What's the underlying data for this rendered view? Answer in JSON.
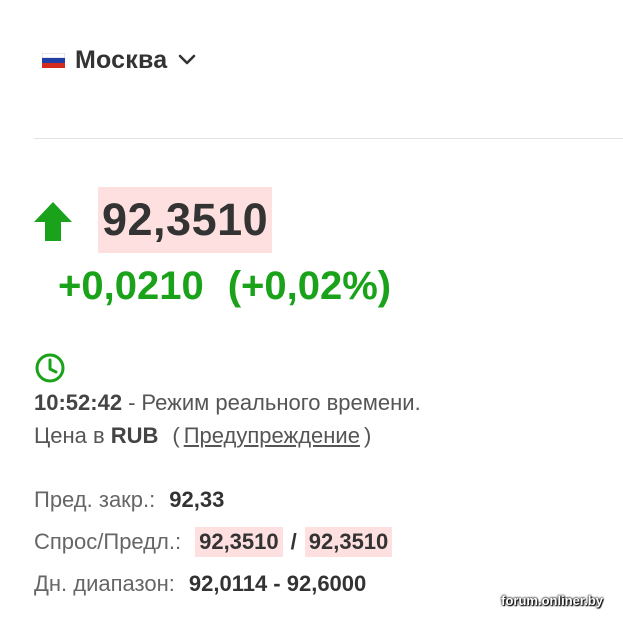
{
  "header": {
    "exchange": "Москва",
    "flag_icon": "russia-flag-icon",
    "dropdown_icon": "chevron-down-icon"
  },
  "quote": {
    "direction_icon": "arrow-up-icon",
    "price": "92,3510",
    "change": "+0,0210",
    "change_percent": "(+0,02%)"
  },
  "realtime": {
    "clock_icon": "clock-icon",
    "time": "10:52:42",
    "separator": "-",
    "mode": "Режим реального времени."
  },
  "currency": {
    "label": "Цена в",
    "code": "RUB",
    "open_paren": "(",
    "warning_link": "Предупреждение",
    "close_paren": ")"
  },
  "stats": {
    "prev_close_label": "Пред. закр.:",
    "prev_close": "92,33",
    "bid_ask_label": "Спрос/Предл.:",
    "bid": "92,3510",
    "bid_ask_separator": "/",
    "ask": "92,3510",
    "day_range_label": "Дн. диапазон:",
    "day_range": "92,0114 - 92,6000"
  },
  "watermark": "forum.onliner.by",
  "colors": {
    "positive": "#1aa31a",
    "highlight": "#ffe0e0",
    "text": "#333333",
    "muted": "#666666"
  }
}
